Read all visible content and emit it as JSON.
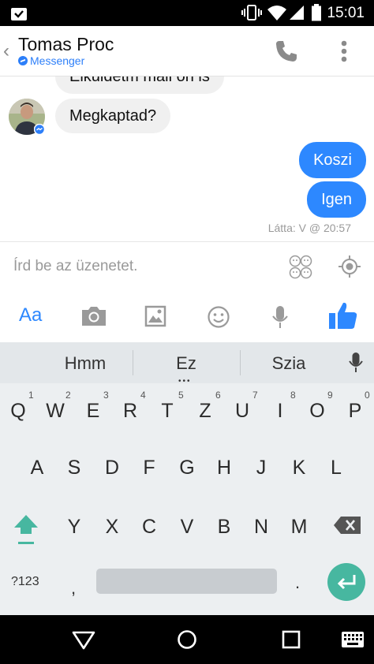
{
  "status_bar": {
    "time": "15:01",
    "icons": [
      "inbox-check-icon",
      "vibrate-icon",
      "wifi-icon",
      "signal-icon",
      "battery-icon"
    ]
  },
  "header": {
    "back_icon": "chevron-left-icon",
    "title": "Tomas Proc",
    "subtitle": "Messenger",
    "actions": [
      "phone-icon",
      "more-vert-icon"
    ]
  },
  "messages": [
    {
      "direction": "in",
      "text": "Elküldetm mail on is",
      "partial": true
    },
    {
      "direction": "in",
      "text": "Megkaptad?",
      "has_avatar": true
    },
    {
      "direction": "out",
      "text": "Koszi"
    },
    {
      "direction": "out",
      "text": "Igen"
    }
  ],
  "seen_receipt": "Látta: V @ 20:57",
  "composer": {
    "placeholder": "Írd be az üzenetet.",
    "right_icons": [
      "stickers-icon",
      "location-icon"
    ],
    "toolbar": [
      "Aa",
      "camera-icon",
      "image-icon",
      "emoji-icon",
      "mic-icon",
      "thumbs-up-icon"
    ],
    "toolbar_text": "Aa"
  },
  "keyboard": {
    "suggestions": [
      "Hmm",
      "Ez",
      "Szia"
    ],
    "row1": [
      "Q",
      "W",
      "E",
      "R",
      "T",
      "Z",
      "U",
      "I",
      "O",
      "P"
    ],
    "row1_nums": [
      "1",
      "2",
      "3",
      "4",
      "5",
      "6",
      "7",
      "8",
      "9",
      "0"
    ],
    "row2": [
      "A",
      "S",
      "D",
      "F",
      "G",
      "H",
      "J",
      "K",
      "L"
    ],
    "row3": [
      "Y",
      "X",
      "C",
      "V",
      "B",
      "N",
      "M"
    ],
    "symbols_key": "?123",
    "comma_key": ",",
    "period_key": "."
  },
  "colors": {
    "messenger_blue": "#2d88ff",
    "enter_key": "#47b7a0",
    "shift_key": "#47b7a0"
  }
}
